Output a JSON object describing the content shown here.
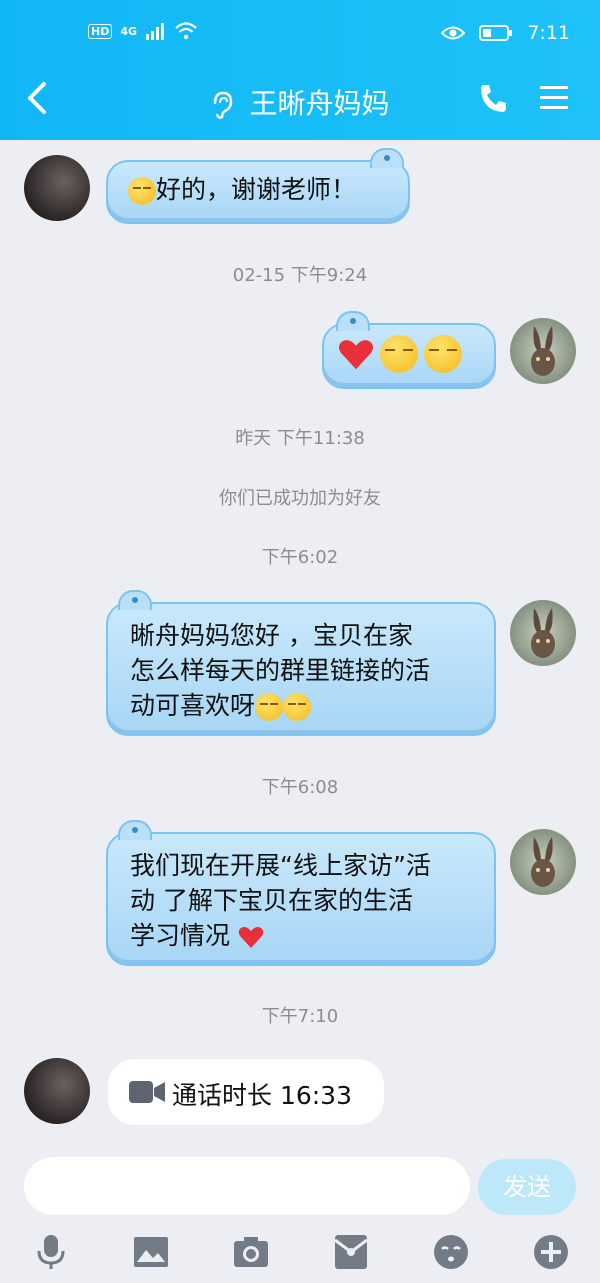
{
  "status_bar": {
    "left_badge": "HD",
    "network": "4G",
    "time": "7:11"
  },
  "header": {
    "title": "王晰舟妈妈"
  },
  "messages": [
    {
      "type": "received",
      "text": "好的，谢谢老师！"
    },
    {
      "type": "timestamp",
      "text": "02-15 下午9:24"
    },
    {
      "type": "sent_emoji"
    },
    {
      "type": "timestamp",
      "text": "昨天 下午11:38"
    },
    {
      "type": "system",
      "text": "你们已成功加为好友"
    },
    {
      "type": "timestamp",
      "text": "下午6:02"
    },
    {
      "type": "sent",
      "lines": [
        "晰舟妈妈您好 ，宝贝在家",
        "怎么样每天的群里链接的活",
        "动可喜欢呀"
      ]
    },
    {
      "type": "timestamp",
      "text": "下午6:08"
    },
    {
      "type": "sent",
      "lines": [
        "我们现在开展“线上家访”活",
        "动 了解下宝贝在家的生活",
        "学习情况"
      ]
    },
    {
      "type": "timestamp",
      "text": "下午7:10"
    },
    {
      "type": "call",
      "text": "通话时长 16:33"
    }
  ],
  "input": {
    "send_label": "发送"
  },
  "toolbar_icons": [
    "microphone-icon",
    "image-icon",
    "camera-icon",
    "red-packet-icon",
    "emoji-icon",
    "plus-icon"
  ],
  "colors": {
    "header": "#10b7f5",
    "bubble": "#b3dcf7",
    "send_button": "#bde8f9"
  }
}
